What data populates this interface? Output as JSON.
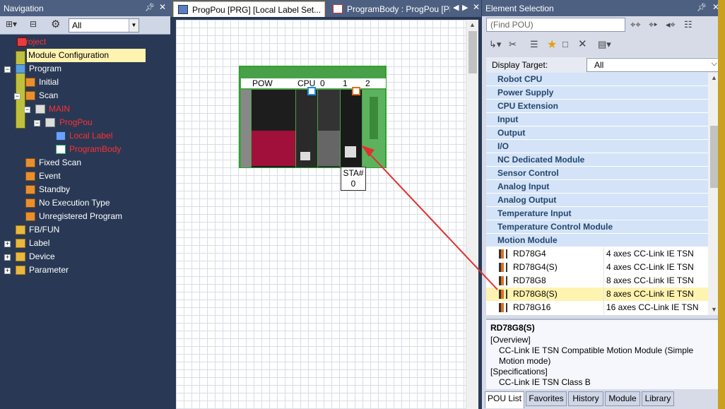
{
  "navigation": {
    "title": "Navigation",
    "filter_value": "All",
    "tree": {
      "project": "Project",
      "module_configuration": "Module Configuration",
      "program": "Program",
      "initial": "Initial",
      "scan": "Scan",
      "main": "MAIN",
      "progpou": "ProgPou",
      "local_label": "Local Label",
      "program_body": "ProgramBody",
      "fixed_scan": "Fixed Scan",
      "event": "Event",
      "standby": "Standby",
      "no_execution_type": "No Execution Type",
      "unregistered_program": "Unregistered Program",
      "fbfun": "FB/FUN",
      "label": "Label",
      "device": "Device",
      "parameter": "Parameter"
    }
  },
  "editor": {
    "tabs": [
      {
        "label": "ProgPou [PRG] [Local Label Set..."
      },
      {
        "label": "ProgramBody : ProgPou [PR"
      }
    ],
    "rack": {
      "slot_labels": [
        "POW",
        "CPU",
        "0",
        "1",
        "2"
      ],
      "station_label": "STA#",
      "station_number": "0"
    }
  },
  "element_selection": {
    "title": "Element Selection",
    "find_placeholder": "(Find POU)",
    "display_target_label": "Display Target:",
    "display_target_value": "All",
    "categories": [
      "Robot CPU",
      "Power Supply",
      "CPU Extension",
      "Input",
      "Output",
      "I/O",
      "NC Dedicated Module",
      "Sensor Control",
      "Analog Input",
      "Analog Output",
      "Temperature Input",
      "Temperature Control Module",
      "Motion Module"
    ],
    "items": [
      {
        "name": "RD78G4",
        "desc": "4 axes CC-Link IE TSN"
      },
      {
        "name": "RD78G4(S)",
        "desc": "4 axes CC-Link IE TSN"
      },
      {
        "name": "RD78G8",
        "desc": "8 axes CC-Link IE TSN"
      },
      {
        "name": "RD78G8(S)",
        "desc": "8 axes CC-Link IE TSN"
      },
      {
        "name": "RD78G16",
        "desc": "16 axes CC-Link IE TSN"
      }
    ],
    "selected_index": 3,
    "description": {
      "title": "RD78G8(S)",
      "overview_label": "[Overview]",
      "overview_text": "CC-Link IE TSN Compatible Motion Module (Simple Motion mode)",
      "specs_label": "[Specifications]",
      "specs_text": "CC-Link IE TSN Class B"
    },
    "bottom_tabs": [
      "POU List",
      "Favorites",
      "History",
      "Module",
      "Library"
    ]
  },
  "colors": {
    "panel_bg": "#293955",
    "title_bg": "#4d6082",
    "selected_bg": "#fff3b0",
    "category_bg": "#d4e3f7",
    "red_text": "#ff3030",
    "arrow": "#e03030"
  }
}
